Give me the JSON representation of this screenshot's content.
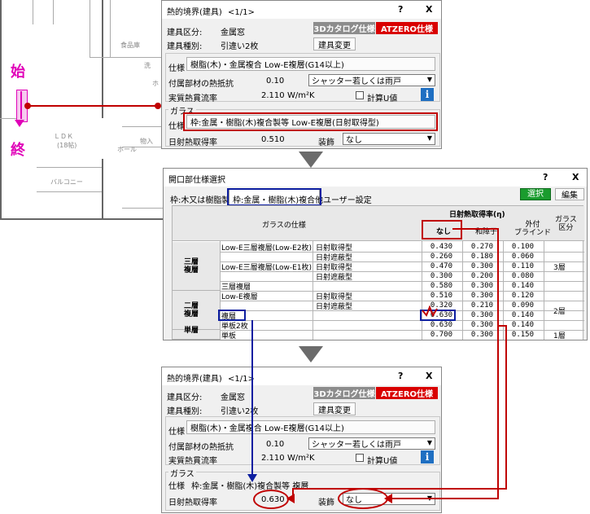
{
  "floorplan": {
    "rooms": [
      "食品庫",
      "ＬＤＫ",
      "(18帖)",
      "ホール",
      "物入",
      "バルコニー",
      "洗",
      "ホ"
    ],
    "start_marker": "始",
    "end_marker": "終"
  },
  "dialog1": {
    "title": "熱的境界(建具)",
    "page": "<1/1>",
    "help": "?",
    "close": "X",
    "kind_label": "建具区分:",
    "kind_value": "金属窓",
    "type_label": "建具種別:",
    "type_value": "引違い2枚",
    "catalog_tab": "3Dカタログ仕様",
    "atzero_tab": "ATZERO仕様",
    "change_button": "建具変更",
    "spec_label": "仕様",
    "spec_value": "樹脂(木)・金属複合 Low-E複層(G14以上)",
    "thermal_label": "付属部材の熱抵抗",
    "thermal_value": "0.10",
    "shutter_select": "シャッター若しくは雨戸",
    "flow_label": "実質熱貫流率",
    "flow_value": "2.110",
    "flow_unit": "W/m²K",
    "calc_u_label": "計算U値",
    "info_icon": "i",
    "glass_group": "ガラス",
    "glass_spec_label": "仕様",
    "glass_spec_value": "枠:金属・樹脂(木)複合製等 Low-E複層(日射取得型)",
    "solar_label": "日射熱取得率",
    "solar_value": "0.510",
    "decor_label": "装飾",
    "decor_select": "なし"
  },
  "dialog2": {
    "title": "開口部仕様選択",
    "help": "?",
    "close": "X",
    "tabs": [
      "枠:木又は樹脂製",
      "枠:金属・樹脂(木)複合他",
      "ユーザー設定"
    ],
    "select_button": "選択",
    "edit_button": "編集",
    "col_glass": "ガラスの仕様",
    "col_solar_group": "日射熱取得率(η)",
    "col_none": "なし",
    "col_shoji": "和障子",
    "col_blind": "外付\nブラインド",
    "col_class": "ガラス\n区分",
    "groups": [
      {
        "name": "三層\n複層",
        "class": "3層"
      },
      {
        "name": "二層\n複層",
        "class": "2層"
      },
      {
        "name": "単層",
        "class": "1層"
      }
    ],
    "rows": [
      {
        "spec": "Low-E三層複層(Low-E2枚)",
        "sub": "日射取得型",
        "vals": [
          "0.430",
          "0.270",
          "0.100"
        ]
      },
      {
        "spec": "",
        "sub": "日射遮蔽型",
        "vals": [
          "0.260",
          "0.180",
          "0.060"
        ]
      },
      {
        "spec": "Low-E三層複層(Low-E1枚)",
        "sub": "日射取得型",
        "vals": [
          "0.470",
          "0.300",
          "0.110"
        ]
      },
      {
        "spec": "",
        "sub": "日射遮蔽型",
        "vals": [
          "0.300",
          "0.200",
          "0.080"
        ]
      },
      {
        "spec": "三層複層",
        "sub": "",
        "vals": [
          "0.580",
          "0.300",
          "0.140"
        ]
      },
      {
        "spec": "Low-E複層",
        "sub": "日射取得型",
        "vals": [
          "0.510",
          "0.300",
          "0.120"
        ]
      },
      {
        "spec": "",
        "sub": "日射遮蔽型",
        "vals": [
          "0.320",
          "0.210",
          "0.090"
        ]
      },
      {
        "spec": "複層",
        "sub": "",
        "vals": [
          "0.630",
          "0.300",
          "0.140"
        ]
      },
      {
        "spec": "単板2枚",
        "sub": "",
        "vals": [
          "0.630",
          "0.300",
          "0.140"
        ]
      },
      {
        "spec": "単板",
        "sub": "",
        "vals": [
          "0.700",
          "0.300",
          "0.150"
        ]
      }
    ]
  },
  "dialog3": {
    "title": "熱的境界(建具)",
    "page": "<1/1>",
    "help": "?",
    "close": "X",
    "kind_label": "建具区分:",
    "kind_value": "金属窓",
    "type_label": "建具種別:",
    "type_value": "引違い2枚",
    "catalog_tab": "3Dカタログ仕様",
    "atzero_tab": "ATZERO仕様",
    "change_button": "建具変更",
    "spec_label": "仕様",
    "spec_value": "樹脂(木)・金属複合 Low-E複層(G14以上)",
    "thermal_label": "付属部材の熱抵抗",
    "thermal_value": "0.10",
    "shutter_select": "シャッター若しくは雨戸",
    "flow_label": "実質熱貫流率",
    "flow_value": "2.110",
    "flow_unit": "W/m²K",
    "calc_u_label": "計算U値",
    "info_icon": "i",
    "glass_group": "ガラス",
    "glass_spec_label": "仕様",
    "glass_spec_value": "枠:金属・樹脂(木)複合製等 複層",
    "solar_label": "日射熱取得率",
    "solar_value": "0.630",
    "decor_label": "装飾",
    "decor_select": "なし"
  },
  "colors": {
    "accent_red": "#c00000",
    "accent_blue": "#0c1ea0",
    "marker_magenta": "#e000b8",
    "select_green": "#1a9c2e"
  }
}
